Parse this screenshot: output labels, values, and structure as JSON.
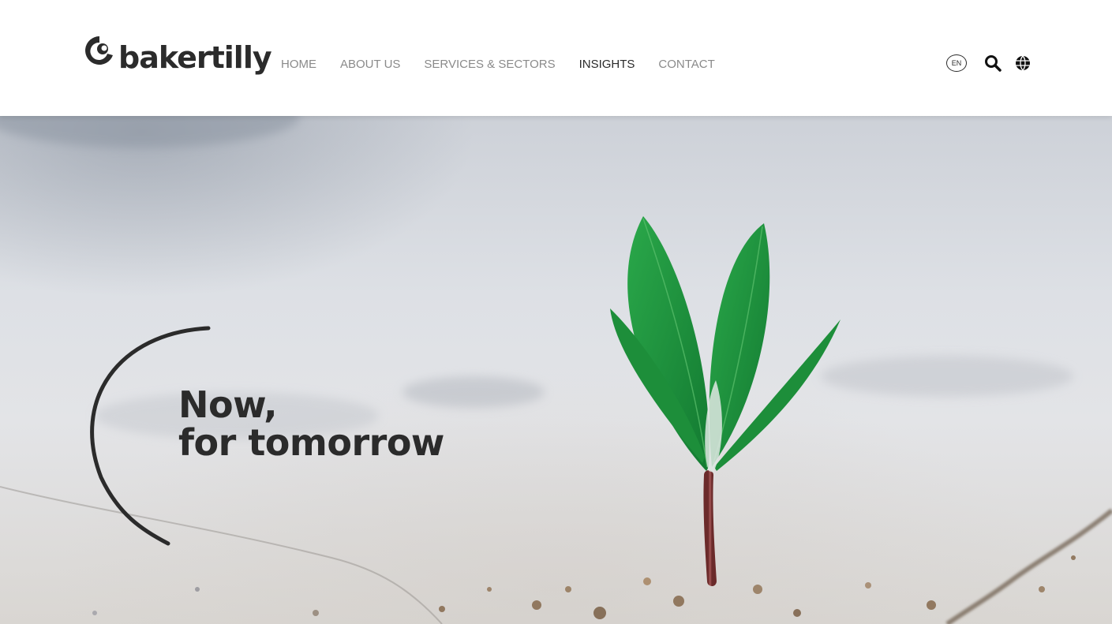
{
  "brand": {
    "name": "bakertilly"
  },
  "nav": {
    "items": [
      {
        "label": "HOME"
      },
      {
        "label": "ABOUT US"
      },
      {
        "label": "SERVICES & SECTORS"
      },
      {
        "label": "INSIGHTS"
      },
      {
        "label": "CONTACT"
      }
    ],
    "active": "INSIGHTS"
  },
  "utility": {
    "language": "EN",
    "search_icon": "search-icon",
    "globe_icon": "globe-icon"
  },
  "hero": {
    "headline_line1": "Now,",
    "headline_line2": "for tomorrow"
  },
  "colors": {
    "text_dark": "#2b2b2b",
    "nav_gray": "#8a8a8a",
    "leaf_green": "#1f9a3c",
    "stem_red": "#8c3a3a"
  }
}
